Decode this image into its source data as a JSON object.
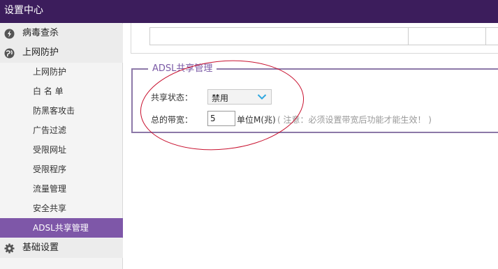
{
  "window": {
    "title": "设置中心"
  },
  "sidebar": {
    "sections": [
      {
        "label": "病毒查杀",
        "icon": "virus-scan-icon"
      },
      {
        "label": "上网防护",
        "icon": "globe-icon"
      },
      {
        "label": "基础设置",
        "icon": "gear-icon"
      }
    ],
    "items": [
      {
        "label": "上网防护"
      },
      {
        "label": "白 名 单"
      },
      {
        "label": "防黑客攻击"
      },
      {
        "label": "广告过滤"
      },
      {
        "label": "受限网址"
      },
      {
        "label": "受限程序"
      },
      {
        "label": "流量管理"
      },
      {
        "label": "安全共享"
      },
      {
        "label": "ADSL共享管理",
        "active": true
      }
    ]
  },
  "adsl": {
    "legend": "ADSL共享管理",
    "share_status_label": "共享状态：",
    "share_status_value": "禁用",
    "bandwidth_label": "总的带宽：",
    "bandwidth_value": "5",
    "bandwidth_unit": "单位M(兆)",
    "bandwidth_note": "( 注意：必须设置带宽后功能才能生效！ )"
  },
  "colors": {
    "titlebar": "#3c1d5c",
    "active_item": "#7e57a8",
    "legend_text": "#7b5aa6",
    "annotation": "#c8102e"
  }
}
